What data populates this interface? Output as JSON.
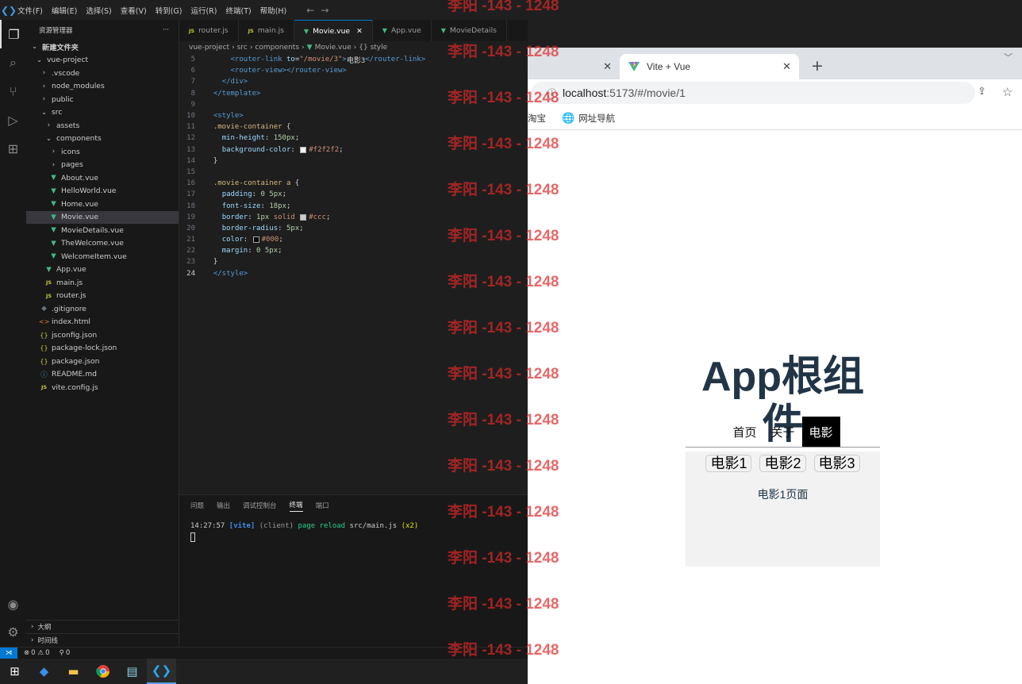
{
  "titlebar": {
    "menu": [
      "文件(F)",
      "编辑(E)",
      "选择(S)",
      "查看(V)",
      "转到(G)",
      "运行(R)",
      "终端(T)",
      "帮助(H)"
    ]
  },
  "sidebar": {
    "title": "资源管理器",
    "more": "···",
    "items": [
      {
        "label": "新建文件夹",
        "depth": 0,
        "icon": "chev-down",
        "bold": true
      },
      {
        "label": "vue-project",
        "depth": 1,
        "icon": "chev-down"
      },
      {
        "label": ".vscode",
        "depth": 2,
        "icon": "chev-right"
      },
      {
        "label": "node_modules",
        "depth": 2,
        "icon": "chev-right"
      },
      {
        "label": "public",
        "depth": 2,
        "icon": "chev-right"
      },
      {
        "label": "src",
        "depth": 2,
        "icon": "chev-down"
      },
      {
        "label": "assets",
        "depth": 3,
        "icon": "chev-right"
      },
      {
        "label": "components",
        "depth": 3,
        "icon": "chev-down"
      },
      {
        "label": "icons",
        "depth": 4,
        "icon": "chev-right"
      },
      {
        "label": "pages",
        "depth": 4,
        "icon": "chev-right"
      },
      {
        "label": "About.vue",
        "depth": 4,
        "icon": "vue"
      },
      {
        "label": "HelloWorld.vue",
        "depth": 4,
        "icon": "vue"
      },
      {
        "label": "Home.vue",
        "depth": 4,
        "icon": "vue"
      },
      {
        "label": "Movie.vue",
        "depth": 4,
        "icon": "vue",
        "selected": true
      },
      {
        "label": "MovieDetails.vue",
        "depth": 4,
        "icon": "vue"
      },
      {
        "label": "TheWelcome.vue",
        "depth": 4,
        "icon": "vue"
      },
      {
        "label": "WelcomeItem.vue",
        "depth": 4,
        "icon": "vue"
      },
      {
        "label": "App.vue",
        "depth": 3,
        "icon": "vue"
      },
      {
        "label": "main.js",
        "depth": 3,
        "icon": "js"
      },
      {
        "label": "router.js",
        "depth": 3,
        "icon": "js"
      },
      {
        "label": ".gitignore",
        "depth": 2,
        "icon": "git"
      },
      {
        "label": "index.html",
        "depth": 2,
        "icon": "html"
      },
      {
        "label": "jsconfig.json",
        "depth": 2,
        "icon": "json"
      },
      {
        "label": "package-lock.json",
        "depth": 2,
        "icon": "json"
      },
      {
        "label": "package.json",
        "depth": 2,
        "icon": "json"
      },
      {
        "label": "README.md",
        "depth": 2,
        "icon": "md"
      },
      {
        "label": "vite.config.js",
        "depth": 2,
        "icon": "js"
      }
    ],
    "outline": "大纲",
    "timeline": "时间线"
  },
  "tabs": [
    {
      "label": "router.js",
      "icon": "js"
    },
    {
      "label": "main.js",
      "icon": "js"
    },
    {
      "label": "Movie.vue",
      "icon": "vue",
      "active": true,
      "close": "✕"
    },
    {
      "label": "App.vue",
      "icon": "vue"
    },
    {
      "label": "MovieDetails",
      "icon": "vue"
    }
  ],
  "breadcrumb": [
    "vue-project",
    "src",
    "components",
    "Movie.vue",
    "{} style"
  ],
  "editor": {
    "lines": [
      {
        "n": "5",
        "tokens": [
          [
            "      ",
            "txt"
          ],
          [
            "<router-link ",
            "tag"
          ],
          [
            "to",
            "attr"
          ],
          [
            "=",
            "pun"
          ],
          [
            "\"/movie/3\"",
            "str"
          ],
          [
            ">",
            "tag"
          ],
          [
            "电影3",
            "txt"
          ],
          [
            "</router-link>",
            "tag"
          ]
        ]
      },
      {
        "n": "6",
        "tokens": [
          [
            "      ",
            "txt"
          ],
          [
            "<router-view>",
            "tag"
          ],
          [
            "</router-view>",
            "tag"
          ]
        ]
      },
      {
        "n": "7",
        "tokens": [
          [
            "    ",
            "txt"
          ],
          [
            "</div>",
            "tag"
          ]
        ]
      },
      {
        "n": "8",
        "tokens": [
          [
            "  ",
            "txt"
          ],
          [
            "</template>",
            "tag"
          ]
        ]
      },
      {
        "n": "9",
        "tokens": []
      },
      {
        "n": "10",
        "tokens": [
          [
            "  ",
            "txt"
          ],
          [
            "<style>",
            "tag"
          ]
        ]
      },
      {
        "n": "11",
        "tokens": [
          [
            "  ",
            "txt"
          ],
          [
            ".movie-container",
            "sel"
          ],
          [
            " {",
            "pun"
          ]
        ]
      },
      {
        "n": "12",
        "tokens": [
          [
            "    ",
            "txt"
          ],
          [
            "min-height",
            "prop"
          ],
          [
            ": ",
            "pun"
          ],
          [
            "150px",
            "num"
          ],
          [
            ";",
            "pun"
          ]
        ]
      },
      {
        "n": "13",
        "tokens": [
          [
            "    ",
            "txt"
          ],
          [
            "background-color",
            "prop"
          ],
          [
            ": ",
            "pun"
          ],
          [
            "#f2f2f2",
            "str",
            "#f2f2f2"
          ],
          [
            ";",
            "pun"
          ]
        ]
      },
      {
        "n": "14",
        "tokens": [
          [
            "  ",
            "txt"
          ],
          [
            "}",
            "pun"
          ]
        ]
      },
      {
        "n": "15",
        "tokens": []
      },
      {
        "n": "16",
        "tokens": [
          [
            "  ",
            "txt"
          ],
          [
            ".movie-container a",
            "sel"
          ],
          [
            " {",
            "pun"
          ]
        ]
      },
      {
        "n": "17",
        "tokens": [
          [
            "    ",
            "txt"
          ],
          [
            "padding",
            "prop"
          ],
          [
            ": ",
            "pun"
          ],
          [
            "0 5px",
            "num"
          ],
          [
            ";",
            "pun"
          ]
        ]
      },
      {
        "n": "18",
        "tokens": [
          [
            "    ",
            "txt"
          ],
          [
            "font-size",
            "prop"
          ],
          [
            ": ",
            "pun"
          ],
          [
            "18px",
            "num"
          ],
          [
            ";",
            "pun"
          ]
        ]
      },
      {
        "n": "19",
        "tokens": [
          [
            "    ",
            "txt"
          ],
          [
            "border",
            "prop"
          ],
          [
            ": ",
            "pun"
          ],
          [
            "1px ",
            "num"
          ],
          [
            "solid ",
            "str"
          ],
          [
            "#ccc",
            "str",
            "#cccccc"
          ],
          [
            ";",
            "pun"
          ]
        ]
      },
      {
        "n": "20",
        "tokens": [
          [
            "    ",
            "txt"
          ],
          [
            "border-radius",
            "prop"
          ],
          [
            ": ",
            "pun"
          ],
          [
            "5px",
            "num"
          ],
          [
            ";",
            "pun"
          ]
        ]
      },
      {
        "n": "21",
        "tokens": [
          [
            "    ",
            "txt"
          ],
          [
            "color",
            "prop"
          ],
          [
            ": ",
            "pun"
          ],
          [
            "#000",
            "str",
            "#000000"
          ],
          [
            ";",
            "pun"
          ]
        ]
      },
      {
        "n": "22",
        "tokens": [
          [
            "    ",
            "txt"
          ],
          [
            "margin",
            "prop"
          ],
          [
            ": ",
            "pun"
          ],
          [
            "0 5px",
            "num"
          ],
          [
            ";",
            "pun"
          ]
        ]
      },
      {
        "n": "23",
        "tokens": [
          [
            "  ",
            "txt"
          ],
          [
            "}",
            "pun"
          ]
        ]
      },
      {
        "n": "24",
        "tokens": [
          [
            "  ",
            "txt"
          ],
          [
            "</style>",
            "tag"
          ]
        ],
        "current": true
      }
    ]
  },
  "panel": {
    "tabs": [
      "问题",
      "输出",
      "调试控制台",
      "终端",
      "端口"
    ],
    "active_tab": "终端",
    "terminal": {
      "time": "14:27:57",
      "tag": "[vite]",
      "client": "(client)",
      "msg": "page reload",
      "file": "src/main.js",
      "count": "(x2)"
    }
  },
  "statusbar": {
    "errors": "0",
    "warnings": "0",
    "ports": "0"
  },
  "browser": {
    "prev_tab_close": "✕",
    "tab_title": "Vite + Vue",
    "tab_close": "✕",
    "new_tab": "+",
    "url_host": "localhost",
    "url_rest": ":5173/#/movie/1",
    "bookmarks": [
      "淘宝",
      "网址导航"
    ]
  },
  "app": {
    "title": "App根组件",
    "nav": [
      "首页",
      "关于",
      "电影"
    ],
    "active_nav": "电影",
    "movie_links": [
      "电影1",
      "电影2",
      "电影3"
    ],
    "page_text": "电影1页面"
  },
  "watermark": "李阳 -143 - 1248",
  "colors": {
    "accent": "#0078d4",
    "vue_green": "#41b883",
    "app_text": "#213547",
    "watermark": "#dc2828"
  }
}
